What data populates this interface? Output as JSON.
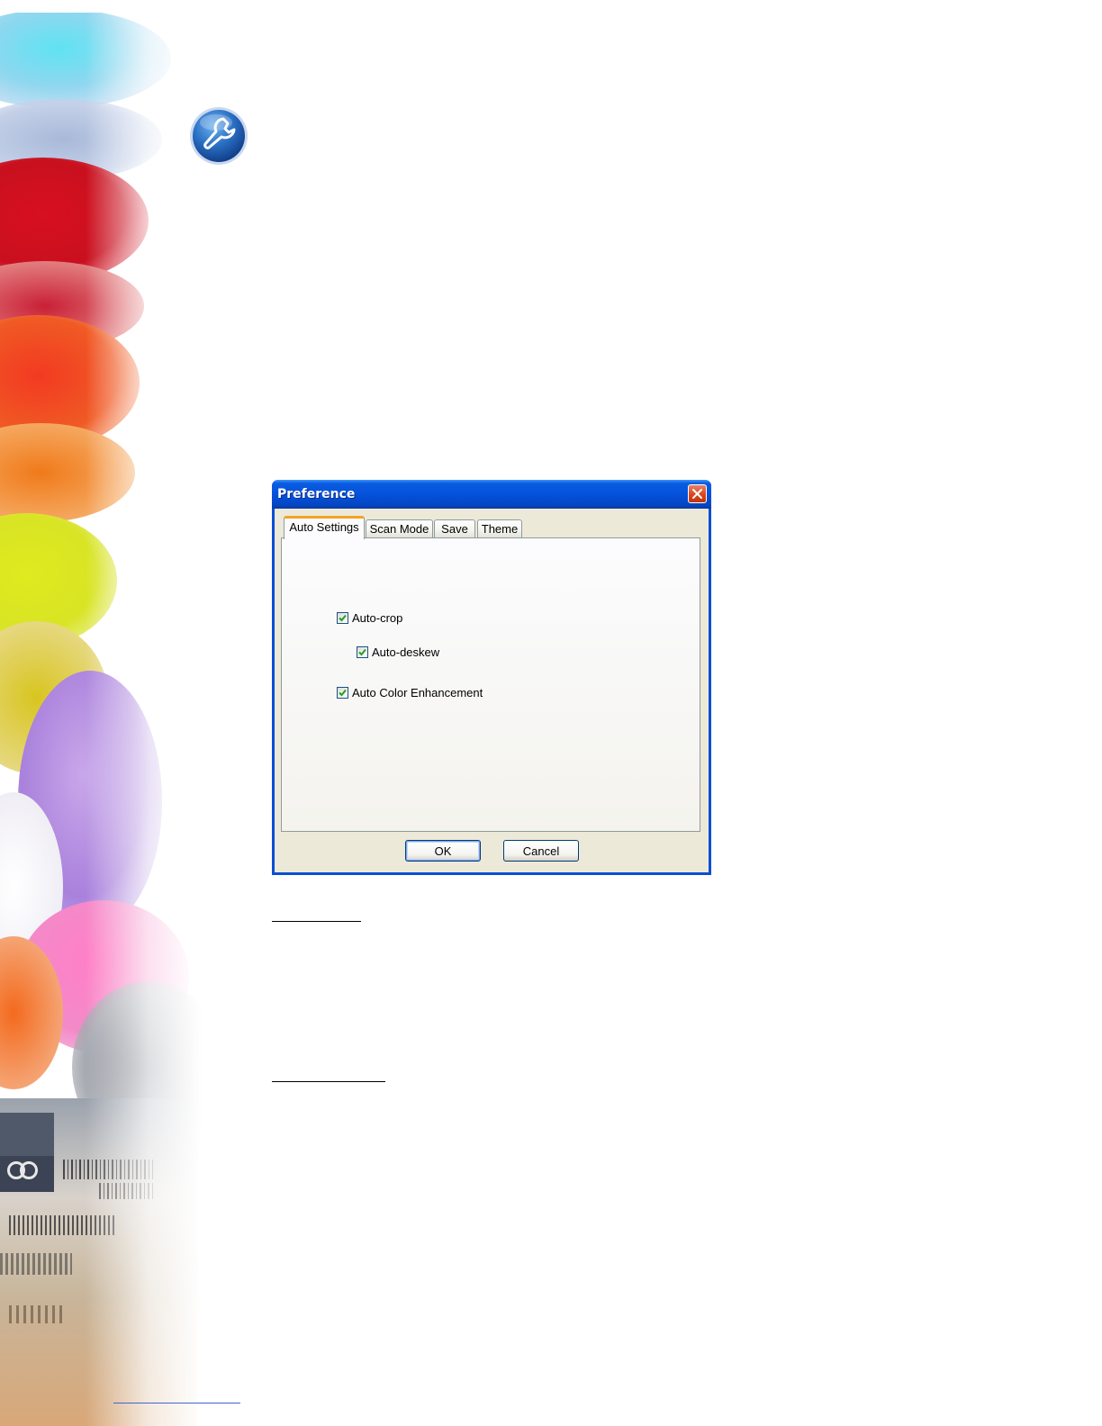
{
  "dialog": {
    "title": "Preference",
    "tabs": [
      {
        "label": "Auto Settings",
        "active": true
      },
      {
        "label": "Scan Mode",
        "active": false
      },
      {
        "label": "Save",
        "active": false
      },
      {
        "label": "Theme",
        "active": false
      }
    ],
    "options": [
      {
        "label": "Auto-crop",
        "checked": true
      },
      {
        "label": "Auto-deskew",
        "checked": true
      },
      {
        "label": "Auto Color Enhancement",
        "checked": true
      }
    ],
    "buttons": {
      "ok": "OK",
      "cancel": "Cancel"
    }
  },
  "icons": {
    "page": "wrench-icon",
    "close": "close-icon",
    "check": "checkmark-icon"
  },
  "colors": {
    "titlebar": "#0552dc",
    "active_tab_accent": "#f4a226",
    "checkmark": "#21a121",
    "close_button": "#d9461f"
  }
}
